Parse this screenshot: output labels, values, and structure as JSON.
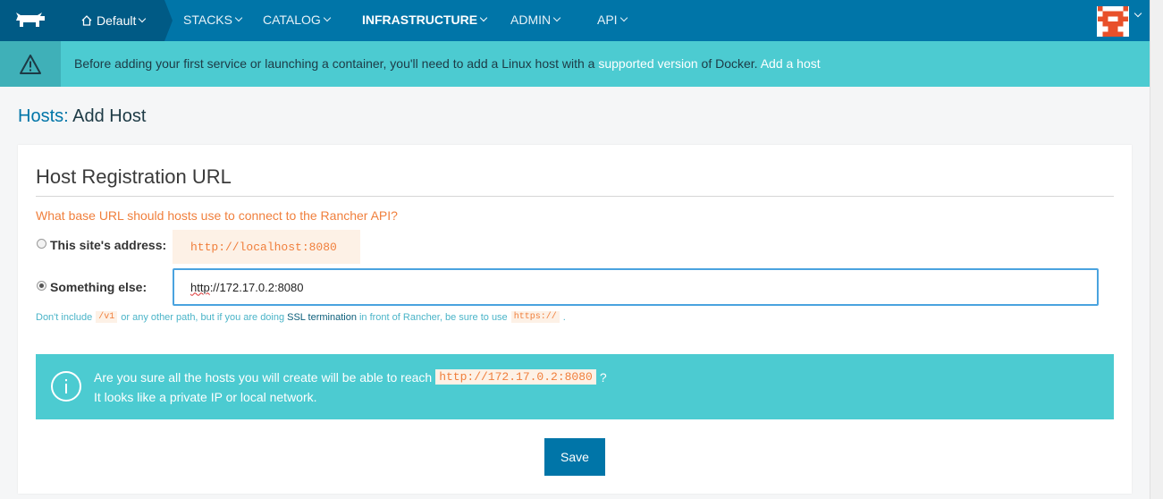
{
  "nav": {
    "environment": "Default",
    "items": [
      "STACKS",
      "CATALOG",
      "INFRASTRUCTURE",
      "ADMIN",
      "API"
    ],
    "active": "INFRASTRUCTURE",
    "icons": {
      "logo": "rancher-cow-logo",
      "home": "home-icon",
      "avatar": "user-avatar"
    }
  },
  "banner": {
    "text_before": "Before adding your first service or launching a container, you'll need to add a Linux host with a ",
    "link_supported": "supported version",
    "text_middle": " of Docker. ",
    "link_add_host": "Add a host",
    "icon": "warning-icon"
  },
  "page": {
    "breadcrumb": "Hosts:",
    "title": "Add Host"
  },
  "card": {
    "title": "Host Registration URL",
    "question": "What base URL should hosts use to connect to the Rancher API?",
    "option_site_label": "This site's address:",
    "option_site_value": "http://localhost:8080",
    "option_else_label": "Something else:",
    "input_value_prefix": "http",
    "input_value_rest": "://172.17.0.2:8080",
    "selected_option": "Something else:",
    "hint": {
      "part1": "Don't include",
      "code1": "/v1",
      "part2": "or any other path, but if you are doing",
      "ssl": "SSL termination",
      "part3": "in front of Rancher, be sure to use",
      "code2": "https://",
      "part4": "."
    },
    "info": {
      "line1_before": "Are you sure all the hosts you will create will be able to reach",
      "line1_code": "http://172.17.0.2:8080",
      "line1_after": "?",
      "line2": "It looks like a private IP or local network.",
      "icon": "info-icon"
    },
    "save_label": "Save"
  },
  "colors": {
    "nav_bg": "#0075a8",
    "nav_dark": "#005a85",
    "banner_bg": "#4ccbd1",
    "accent_orange": "#f07f3c",
    "input_border": "#4aa3df"
  }
}
